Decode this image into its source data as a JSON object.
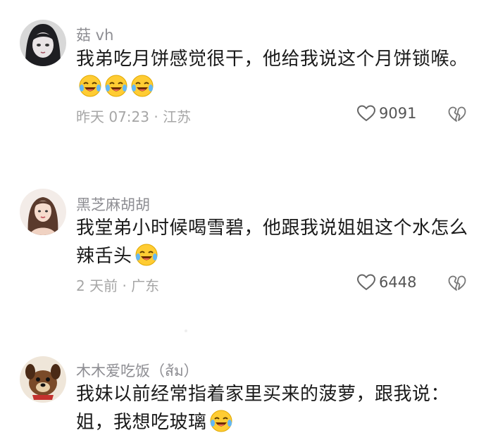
{
  "comments": [
    {
      "username": "菇 vh",
      "text": "我弟吃月饼感觉很干，他给我说这个月饼锁喉。",
      "emoji_count": 3,
      "meta": "昨天 07:23 · 江苏",
      "likes": "9091",
      "avatar_icon": "avatar-anime-girl"
    },
    {
      "username": "黑芝麻胡胡",
      "text": "我堂弟小时候喝雪碧，他跟我说姐姐这个水怎么辣舌头",
      "emoji_count": 1,
      "meta": "2 天前 · 广东",
      "likes": "6448",
      "avatar_icon": "avatar-woman-portrait"
    },
    {
      "username": "木木爱吃饭（ส้ม）",
      "text": "我妹以前经常指着家里买来的菠萝，跟我说：姐，我想吃玻璃",
      "emoji_count": 1,
      "meta": "",
      "likes": "",
      "avatar_icon": "avatar-cartoon-dog"
    }
  ],
  "colors": {
    "username": "#8e8e93",
    "meta": "#a6a6a6",
    "emoji_face": "#ffcc33"
  },
  "icons": {
    "like": "heart-outline-icon",
    "dislike": "broken-heart-icon",
    "emoji": "laughing-crying-emoji"
  }
}
